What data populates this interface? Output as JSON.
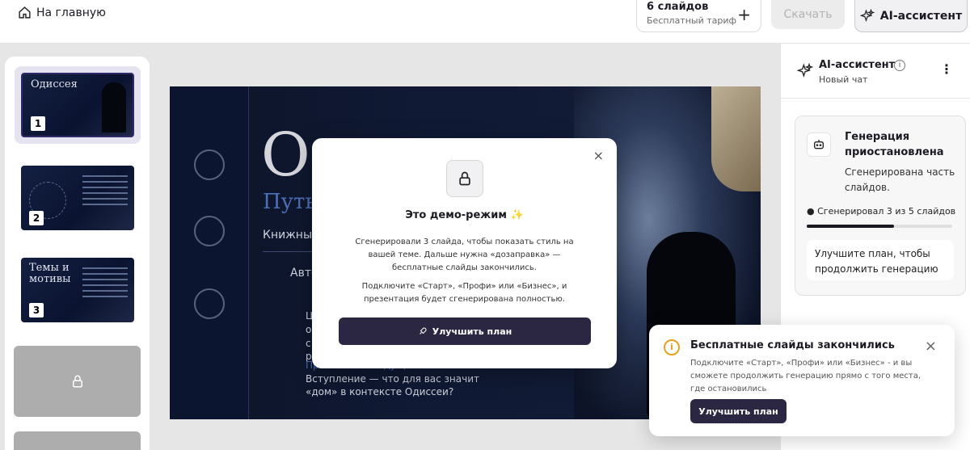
{
  "header": {
    "home_label": "На главную",
    "slides_count": "6 слайдов",
    "tariff": "Бесплатный тариф",
    "plus": "+",
    "download_label": "Скачать",
    "ai_button_label": "AI-ассистент"
  },
  "slides": [
    {
      "number": "1",
      "title": "Одиссея"
    },
    {
      "number": "2",
      "title": ""
    },
    {
      "number": "3",
      "title": "Темы и мотивы"
    }
  ],
  "main_slide": {
    "big_letter": "О",
    "subtitle": "Путь",
    "small_line": "Книжный",
    "author": "Авто",
    "bullet": "Ц\nо\nс\nр",
    "note_title": "Примечание ведущего:",
    "note_text": "Вступление — что для вас значит «дом» в контексте Одиссеи?"
  },
  "modal": {
    "close": "×",
    "title": "Это демо-режим ✨",
    "text1": "Сгенерировали 3 слайда, чтобы показать стиль на вашей теме. Дальше нужна «дозаправка» — бесплатные слайды закончились.",
    "text2": "Подключите «Старт», «Профи» или «Бизнес», и презентация будет сгенерирована полностью.",
    "button_label": "Улучшить план"
  },
  "assistant": {
    "title": "AI-ассистент",
    "info": "i",
    "subtitle": "Новый чат",
    "menu": "⋮",
    "gen_title": "Генерация приостановлена",
    "gen_desc": "Сгенерирована часть слайдов.",
    "progress_label": "Сгенерировал 3 из 5 слайдов",
    "progress_value": 0.6,
    "upgrade_text": "Улучшите план, чтобы продолжить генерацию"
  },
  "toast": {
    "icon": "i",
    "title": "Бесплатные слайды закончились",
    "close": "×",
    "text": "Подключите «Старт», «Профи» или «Бизнес» - и вы сможете продолжить генерацию прямо с того места, где остановились",
    "button_label": "Улучшить план"
  },
  "colors": {
    "accent_dark": "#2b2641",
    "warning": "#e7a21b",
    "slide_blue": "#4c6fb8"
  }
}
